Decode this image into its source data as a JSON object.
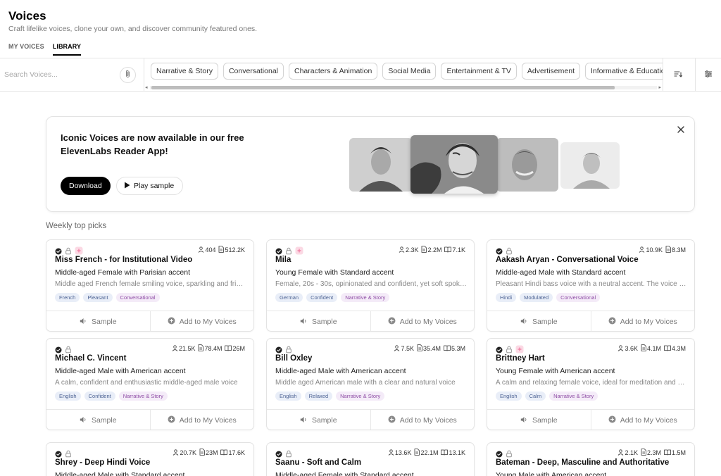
{
  "page": {
    "title": "Voices",
    "subtitle": "Craft lifelike voices, clone your own, and discover community featured ones."
  },
  "tabs": [
    {
      "label": "MY VOICES",
      "active": false
    },
    {
      "label": "LIBRARY",
      "active": true
    }
  ],
  "search": {
    "placeholder": "Search Voices..."
  },
  "categories": [
    "Narrative & Story",
    "Conversational",
    "Characters & Animation",
    "Social Media",
    "Entertainment & TV",
    "Advertisement",
    "Informative & Educational"
  ],
  "banner": {
    "title_line1": "Iconic Voices are now available in our free",
    "title_line2": "ElevenLabs Reader App!",
    "download_label": "Download",
    "play_label": "Play sample"
  },
  "weekly": {
    "label": "Weekly top picks",
    "actions": {
      "sample": "Sample",
      "add": "Add to My Voices"
    },
    "cards": [
      {
        "name": "Miss French - for Institutional Video",
        "accent": "Middle-aged Female with Parisian accent",
        "description": "Middle aged French female smiling voice, sparkling and friendly",
        "tags": [
          "French",
          "Pleasant",
          "Conversational"
        ],
        "users": "404",
        "chars": "512.2K",
        "book": "",
        "pink": true
      },
      {
        "name": "Mila",
        "accent": "Young Female with Standard accent",
        "description": "Female, 20s - 30s, opinionated and confident, yet soft spoken",
        "tags": [
          "German",
          "Confident",
          "Narrative & Story"
        ],
        "users": "2.3K",
        "chars": "2.2M",
        "book": "7.1K",
        "pink": true
      },
      {
        "name": "Aakash Aryan - Conversational Voice",
        "accent": "Middle-aged Male with Standard accent",
        "description": "Pleasant Hindi bass voice with a neutral accent. The voice is smooth",
        "tags": [
          "Hindi",
          "Modulated",
          "Conversational"
        ],
        "users": "10.9K",
        "chars": "8.3M",
        "book": "",
        "pink": false
      },
      {
        "name": "Michael C. Vincent",
        "accent": "Middle-aged Male with American accent",
        "description": "A calm, confident and enthusiastic middle-aged male voice",
        "tags": [
          "English",
          "Confident",
          "Narrative & Story"
        ],
        "users": "21.5K",
        "chars": "78.4M",
        "book": "26M",
        "pink": false
      },
      {
        "name": "Bill Oxley",
        "accent": "Middle-aged Male with American accent",
        "description": "Middle aged American male with a clear and natural voice",
        "tags": [
          "English",
          "Relaxed",
          "Narrative & Story"
        ],
        "users": "7.5K",
        "chars": "35.4M",
        "book": "5.3M",
        "pink": false
      },
      {
        "name": "Brittney Hart",
        "accent": "Young Female with American accent",
        "description": "A calm and relaxing female voice, ideal for meditation and sleep",
        "tags": [
          "English",
          "Calm",
          "Narrative & Story"
        ],
        "users": "3.6K",
        "chars": "4.1M",
        "book": "4.3M",
        "pink": true
      },
      {
        "name": "Shrey - Deep Hindi Voice",
        "accent": "Middle-aged Male with Standard accent",
        "description": "",
        "tags": [],
        "users": "20.7K",
        "chars": "23M",
        "book": "17.6K",
        "pink": false
      },
      {
        "name": "Saanu - Soft and Calm",
        "accent": "Middle-aged Female with Standard accent",
        "description": "",
        "tags": [],
        "users": "13.6K",
        "chars": "22.1M",
        "book": "13.1K",
        "pink": false
      },
      {
        "name": "Bateman - Deep, Masculine and Authoritative",
        "accent": "Young Male with American accent",
        "description": "",
        "tags": [],
        "users": "2.1K",
        "chars": "2.3M",
        "book": "1.5M",
        "pink": false
      }
    ]
  },
  "colors": {
    "tag_language_bg": "#e9eef8",
    "tag_style_bg": "#f4ebf8",
    "tag_use_case_color": "#8e4da5",
    "primary_button": "#000000"
  },
  "icons": [
    "paperclip-icon",
    "sort-icon",
    "filter-sliders-icon",
    "close-icon",
    "play-icon",
    "verified-icon",
    "lock-icon",
    "user-icon",
    "document-icon",
    "book-icon",
    "speaker-icon",
    "plus-circle-icon"
  ]
}
